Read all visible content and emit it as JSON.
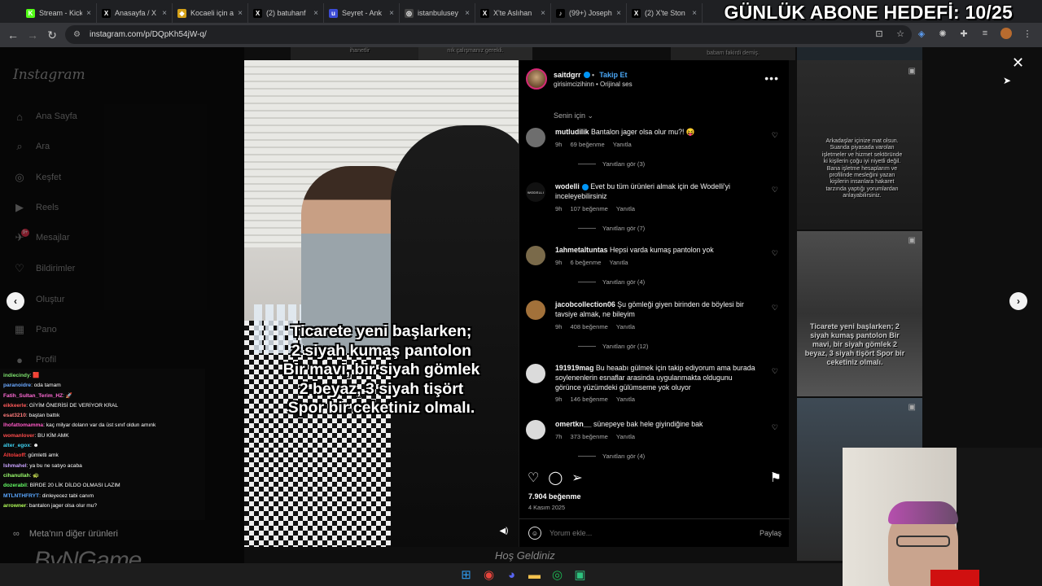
{
  "browser": {
    "tabs": [
      {
        "label": "Stream - Kick",
        "icon": "kick-icon",
        "color": "#53fc18",
        "glyph": "K"
      },
      {
        "label": "Anasayfa / X",
        "icon": "x-icon",
        "color": "#000000",
        "glyph": "X"
      },
      {
        "label": "Kocaeli için ay",
        "icon": "shield-icon",
        "color": "#d4a017",
        "glyph": "◆"
      },
      {
        "label": "(2) batuhanf",
        "icon": "x-icon",
        "color": "#000000",
        "glyph": "X"
      },
      {
        "label": "Seyret - Ank",
        "icon": "u-icon",
        "color": "#3b4bd6",
        "glyph": "u"
      },
      {
        "label": "istanbulusey",
        "icon": "instagram-icon",
        "color": "#444444",
        "glyph": "◎"
      },
      {
        "label": "X'te Aslıhan",
        "icon": "x-icon",
        "color": "#000000",
        "glyph": "X"
      },
      {
        "label": "(99+) Joseph",
        "icon": "tiktok-icon",
        "color": "#000000",
        "glyph": "♪"
      },
      {
        "label": "(2) X'te Ston",
        "icon": "x-icon",
        "color": "#000000",
        "glyph": "X"
      }
    ],
    "url": "instagram.com/p/DQpKh54jW-q/"
  },
  "overlay": {
    "sub_goal": "GÜNLÜK ABONE HEDEFİ: 10/25",
    "watermark": "ByNGame"
  },
  "sidebar": {
    "logo": "Instagram",
    "items": [
      {
        "label": "Ana Sayfa",
        "icon": "home-icon",
        "glyph": "⌂"
      },
      {
        "label": "Ara",
        "icon": "search-icon",
        "glyph": "⌕"
      },
      {
        "label": "Keşfet",
        "icon": "compass-icon",
        "glyph": "◎"
      },
      {
        "label": "Reels",
        "icon": "reels-icon",
        "glyph": "▶"
      },
      {
        "label": "Mesajlar",
        "icon": "messages-icon",
        "glyph": "✈",
        "badge": "9+"
      },
      {
        "label": "Bildirimler",
        "icon": "heart-icon",
        "glyph": "♡"
      },
      {
        "label": "Oluştur",
        "icon": "create-icon",
        "glyph": "⊕"
      },
      {
        "label": "Pano",
        "icon": "dashboard-icon",
        "glyph": "▦"
      },
      {
        "label": "Profil",
        "icon": "profile-icon",
        "glyph": "●"
      }
    ],
    "more": "Meta'nın diğer ürünleri"
  },
  "chat": [
    {
      "user": "indiecindy",
      "color": "#7ee36f",
      "text": ": 🟥"
    },
    {
      "user": "paranoidre",
      "color": "#6aa8ff",
      "text": ": oda tamam"
    },
    {
      "user": "Fatih_Sultan_Terim_HZ",
      "color": "#ff6ad5",
      "text": ": 🚀"
    },
    {
      "user": "eikkeerle",
      "color": "#ff5a5a",
      "text": ": GİYİM ÖNERİSİ DE VERİYOR KRAL"
    },
    {
      "user": "esat3210",
      "color": "#ff7b7b",
      "text": ": baştan battık"
    },
    {
      "user": "lhofattomamma",
      "color": "#ff59c6",
      "text": ": kaç milyar doların var da üst sınıf oldun amınk"
    },
    {
      "user": "womanlover",
      "color": "#ff4d4d",
      "text": ": BU KİM AMK"
    },
    {
      "user": "alter_egox",
      "color": "#3ed1f0",
      "text": ": ☻"
    },
    {
      "user": "Altolaoff",
      "color": "#ff3f3f",
      "text": ": gümletti amk"
    },
    {
      "user": "Ishmahel",
      "color": "#c9a3ff",
      "text": ": ya bu ne satıyo acaba"
    },
    {
      "user": "cihanullah",
      "color": "#9cff6e",
      "text": ": 🐢"
    },
    {
      "user": "dozerabil",
      "color": "#66ff66",
      "text": ": BİRDE 20 LİK DİLDO OLMASI LAZIM"
    },
    {
      "user": "MTLNTHFRYT",
      "color": "#5aa7ff",
      "text": ": dinleyecez tabi canım"
    },
    {
      "user": "arrowner",
      "color": "#b2ff59",
      "text": ": bantalon jager olsa olur mu?"
    }
  ],
  "post": {
    "author": "saitdgrr",
    "follow": "Takip Et",
    "subtitle": "girisimcizihinn • Orijinal ses",
    "sort": "Senin için",
    "caption": [
      "Ticarete yeni başlarken;",
      "2 siyah kumaş pantolon",
      "Bir mavi, bir siyah gömlek",
      "2 beyaz, 3 siyah tişört",
      "Spor bir ceketiniz olmalı."
    ],
    "likes": "7.904 beğenme",
    "date": "4 Kasım 2025",
    "comment_placeholder": "Yorum ekle...",
    "post_label": "Paylaş"
  },
  "comments": [
    {
      "user": "mutludilik",
      "text": "Bantalon jager olsa olur mu?! 😝",
      "time": "9h",
      "likes": "69 beğenme",
      "reply": "Yanıtla",
      "replies": "Yanıtları gör (3)",
      "avatar": "#6e6e6e"
    },
    {
      "user": "wodelli",
      "verified": true,
      "text": "Evet bu tüm ürünleri almak için de Wodelli'yi inceleyebilirsiniz",
      "time": "9h",
      "likes": "107 beğenme",
      "reply": "Yanıtla",
      "replies": "Yanıtları gör (7)",
      "avatar": "#111111",
      "avatar_text": "WODELLI"
    },
    {
      "user": "1ahmetaltuntas",
      "text": "Hepsi varda kumaş pantolon yok",
      "time": "9h",
      "likes": "6 beğenme",
      "reply": "Yanıtla",
      "replies": "Yanıtları gör (4)",
      "avatar": "#7a6a4a"
    },
    {
      "user": "jacobcollection06",
      "text": "Şu gömleği giyen birinden de böylesi bir tavsiye almak, ne bileyim",
      "time": "9h",
      "likes": "408 beğenme",
      "reply": "Yanıtla",
      "replies": "Yanıtları gör (12)",
      "avatar": "#a2713a"
    },
    {
      "user": "191919mag",
      "text": "Bu heaabı gülmek için takip ediyorum ama burada soylenenlerin esnaflar arasinda uygulanmakta oldugunu görünce yüzümdeki gülümseme yok oluyor",
      "time": "9h",
      "likes": "146 beğenme",
      "reply": "Yanıtla",
      "avatar": "#dbdbdb"
    },
    {
      "user": "omertkn__",
      "text": "sünepeye bak hele giyindiğine bak",
      "time": "7h",
      "likes": "373 beğenme",
      "reply": "Yanıtla",
      "replies": "Yanıtları gör (4)",
      "avatar": "#dbdbdb"
    }
  ],
  "feed": {
    "right_text_1": "Arkadaşlar içinize mat olsun. Suanda piyasada varolan işletmeler ve hizmet sektöründe ki kişilerin çoğu iyi niyetli değil. Bana işletme hesaplarım ve profilinde mesleğini yazan kişilerin insanlara hakaret tarzında yaptığı yorumlardan anlayabilirsiniz.",
    "right_text_2": "Ticarete yeni başlarken; 2 siyah kumaş pantolon Bir mavi, bir siyah gömlek 2 beyaz, 3 siyah tişört Spor bir ceketiniz olmalı.",
    "top_text_1": "ihanetlir",
    "top_text_2": "nık çalışmanız gerekli.",
    "top_text_3": "babam fakirdi demiş.",
    "bottom_text": "Hoş Geldiniz"
  },
  "taskbar": [
    {
      "icon": "windows-icon",
      "glyph": "⊞",
      "color": "#2f9bf0"
    },
    {
      "icon": "chrome-icon",
      "glyph": "◉",
      "color": "#e8453c"
    },
    {
      "icon": "discord-icon",
      "glyph": "◕",
      "color": "#5865f2"
    },
    {
      "icon": "folder-icon",
      "glyph": "▬",
      "color": "#f2c14e"
    },
    {
      "icon": "spotify-icon",
      "glyph": "◎",
      "color": "#1db954"
    },
    {
      "icon": "app-icon",
      "glyph": "▣",
      "color": "#2ec27e"
    }
  ]
}
